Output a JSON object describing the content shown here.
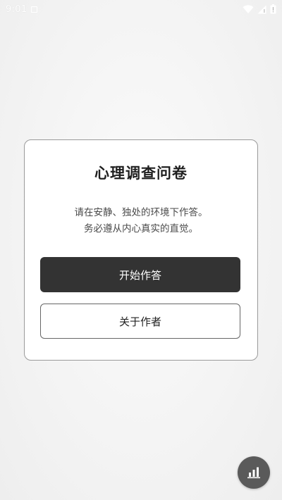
{
  "status_bar": {
    "time": "9:01",
    "icons": [
      "notification-icon",
      "wifi-icon",
      "signal-icon",
      "battery-icon"
    ]
  },
  "card": {
    "title": "心理调查问卷",
    "description_lines": [
      "请在安静、独处的环境下作答。",
      "务必遵从内心真实的直觉。"
    ],
    "primary_button_label": "开始作答",
    "secondary_button_label": "关于作者"
  },
  "fab": {
    "icon": "bar-chart-icon"
  },
  "colors": {
    "primary_button": "#333333",
    "card_border": "#9a9a9a",
    "fab": "#5a5a5a"
  }
}
